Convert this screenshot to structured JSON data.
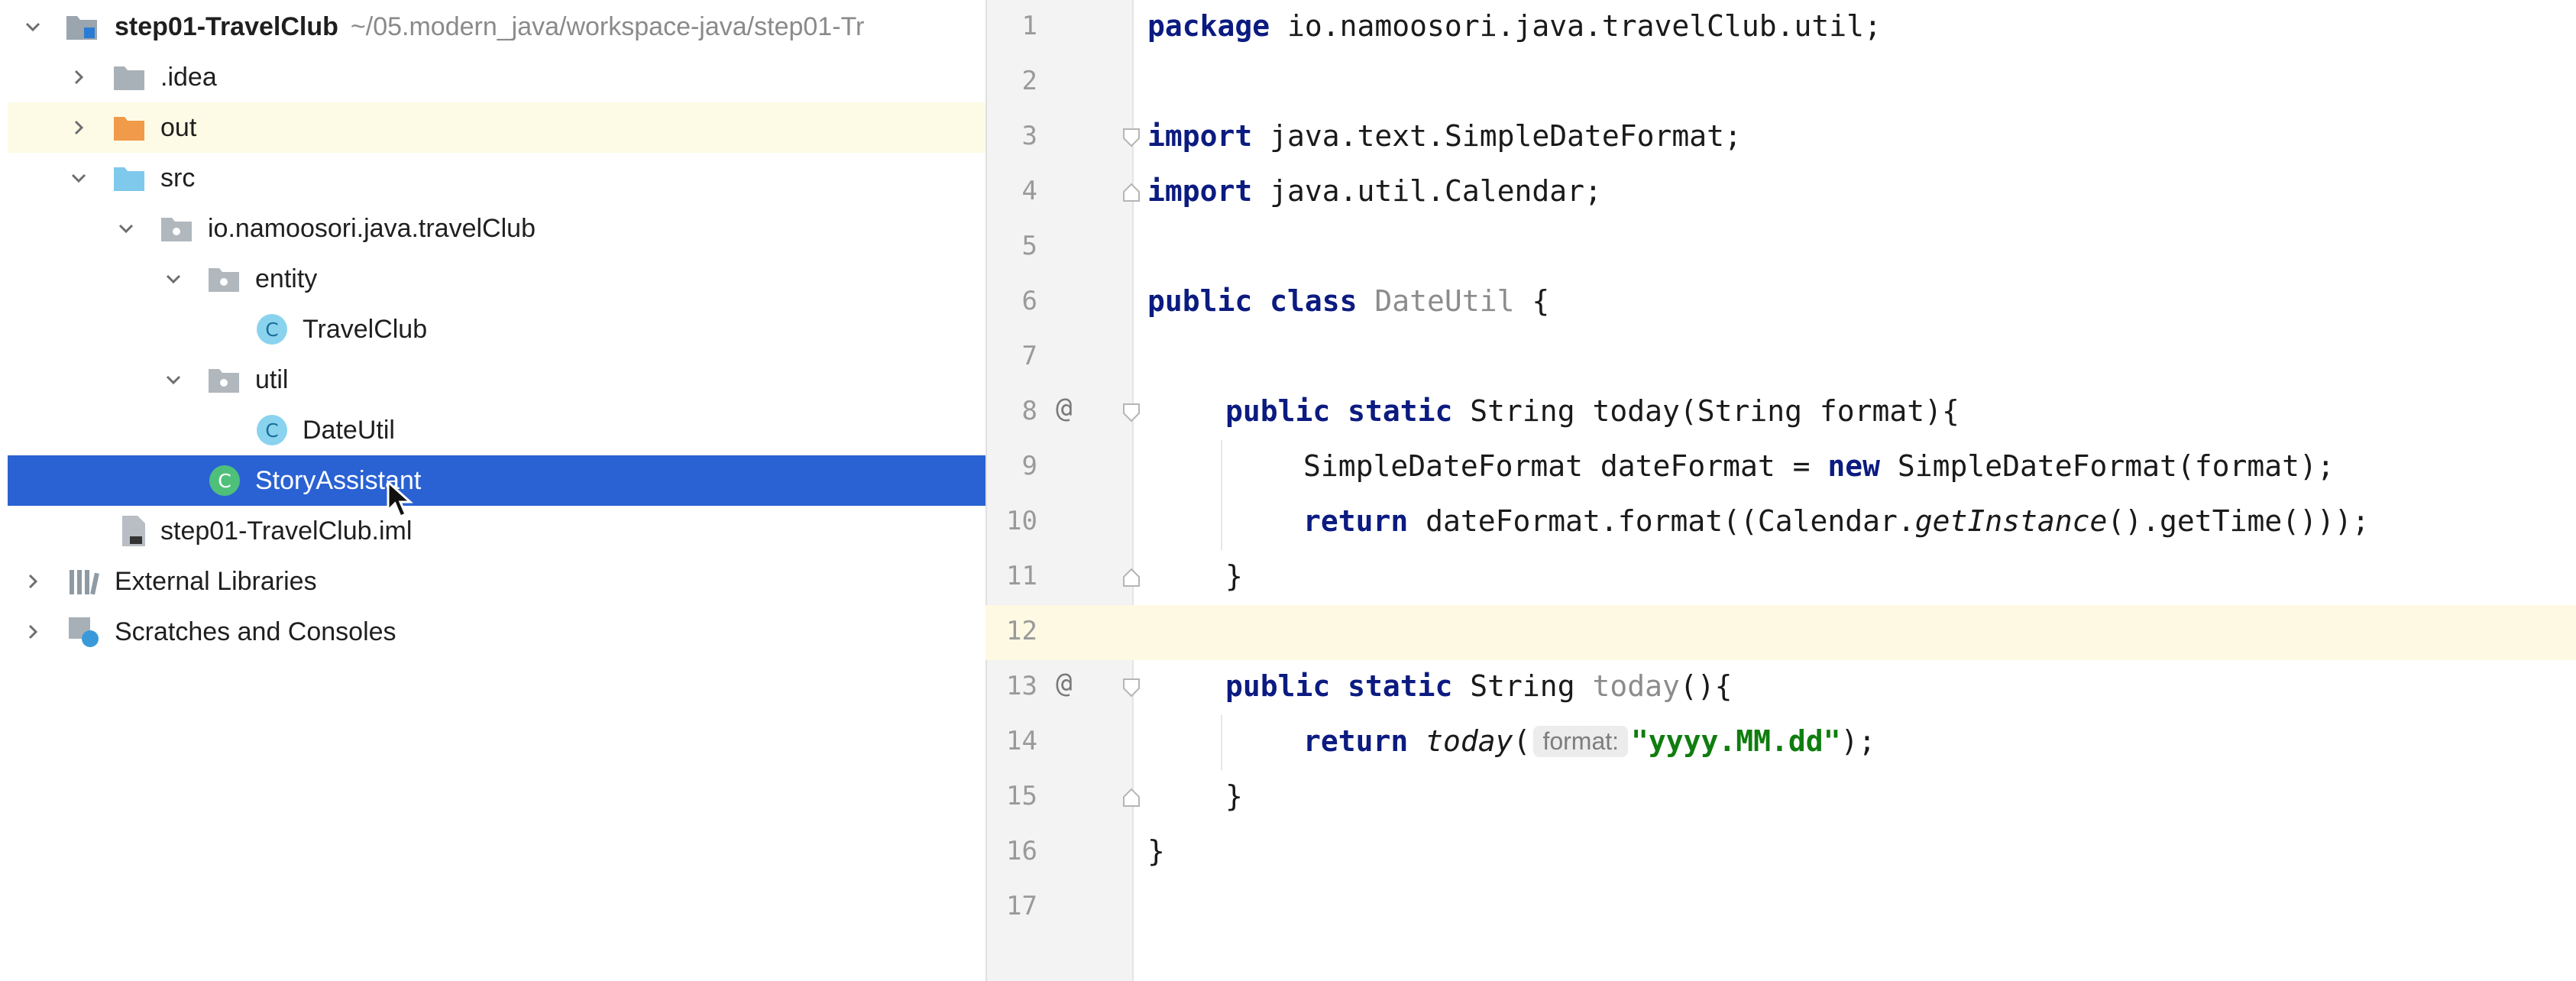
{
  "project_tree": {
    "root": {
      "name": "step01-TravelClub",
      "path": "~/05.modern_java/workspace-java/step01-Tr"
    },
    "items": [
      {
        "label": ".idea"
      },
      {
        "label": "out"
      },
      {
        "label": "src"
      },
      {
        "label": "io.namoosori.java.travelClub"
      },
      {
        "label": "entity"
      },
      {
        "label": "TravelClub"
      },
      {
        "label": "util"
      },
      {
        "label": "DateUtil"
      },
      {
        "label": "StoryAssistant"
      },
      {
        "label": "step01-TravelClub.iml"
      },
      {
        "label": "External Libraries"
      },
      {
        "label": "Scratches and Consoles"
      }
    ],
    "class_badge": "C"
  },
  "editor": {
    "line_numbers": [
      "1",
      "2",
      "3",
      "4",
      "5",
      "6",
      "7",
      "8",
      "9",
      "10",
      "11",
      "12",
      "13",
      "14",
      "15",
      "16",
      "17"
    ],
    "override_marker": "@",
    "tokens": {
      "l1_kw": "package",
      "l1_rest": " io.namoosori.java.travelClub.util;",
      "l3_kw": "import",
      "l3_rest": " java.text.SimpleDateFormat;",
      "l4_kw": "import",
      "l4_rest": " java.util.Calendar;",
      "l6_kw": "public class",
      "l6_cls": " DateUtil",
      "l6_rest": " {",
      "l8_kw": "public static",
      "l8_rest": " String today(String format){",
      "l9_a": "SimpleDateFormat dateFormat = ",
      "l9_kw": "new",
      "l9_b": " SimpleDateFormat(format);",
      "l10_kw": "return",
      "l10_a": " dateFormat.format((Calendar.",
      "l10_it": "getInstance",
      "l10_b": "().getTime()));",
      "l11": "}",
      "l13_kw": "public static",
      "l13_a": " String ",
      "l13_cls": "today",
      "l13_b": "(){",
      "l14_kw": "return",
      "l14_sp": " ",
      "l14_it": "today",
      "l14_paren": "(",
      "l14_hint": "format:",
      "l14_str": "\"yyyy.MM.dd\"",
      "l14_end": ");",
      "l15": "}",
      "l16": "}"
    }
  }
}
